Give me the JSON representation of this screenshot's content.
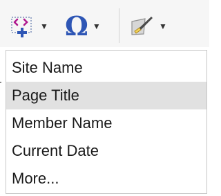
{
  "toolbar": {
    "buttons": [
      {
        "name": "insert-field-button",
        "icon": "insert-field-icon",
        "has_dropdown": true
      },
      {
        "name": "symbol-button",
        "icon": "omega-icon",
        "glyph": "Ω",
        "has_dropdown": true
      },
      {
        "name": "paint-button",
        "icon": "paintbrush-icon",
        "has_dropdown": true
      }
    ],
    "caret": "▼"
  },
  "menu": {
    "items": [
      {
        "label": "Site Name",
        "highlighted": false
      },
      {
        "label": "Page Title",
        "highlighted": true
      },
      {
        "label": "Member Name",
        "highlighted": false
      },
      {
        "label": "Current Date",
        "highlighted": false
      },
      {
        "label": "More...",
        "highlighted": false
      }
    ]
  },
  "colors": {
    "accent_blue": "#2e56b5",
    "icon_purple": "#b0188f",
    "highlight": "#e1e1e1",
    "border": "#c6c6c6"
  }
}
